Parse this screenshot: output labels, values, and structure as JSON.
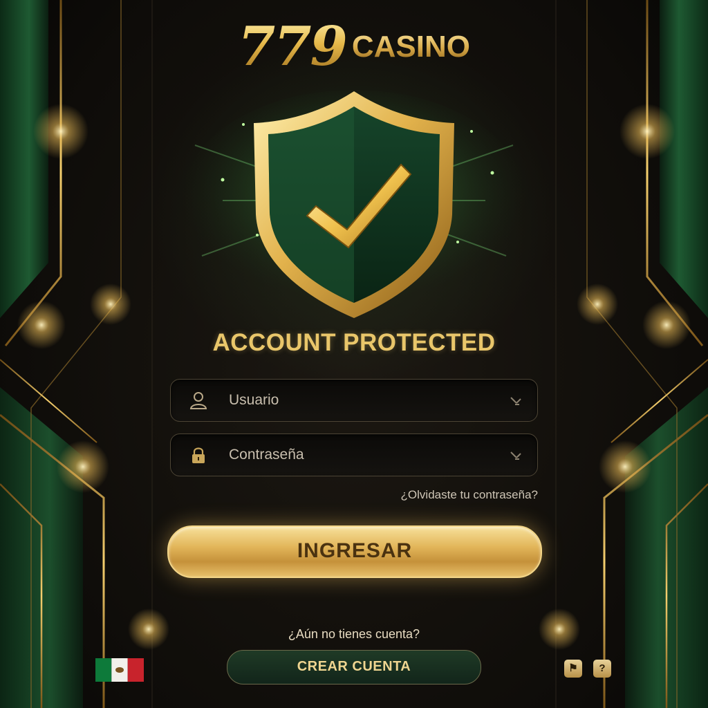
{
  "brand": {
    "number": "779",
    "word": "CASINO"
  },
  "status": {
    "title": "ACCOUNT PROTECTED"
  },
  "form": {
    "username_placeholder": "Usuario",
    "password_placeholder": "Contraseña",
    "forgot_link": "¿Olvidaste tu contraseña?",
    "login_button": "INGRESAR"
  },
  "signup": {
    "prompt": "¿Aún no tienes cuenta?",
    "create_button": "CREAR CUENTA"
  },
  "footer": {
    "language_flag": "mexico-flag-icon",
    "icons": [
      "support-icon",
      "help-icon"
    ]
  },
  "colors": {
    "gold": "#e9c66a",
    "accent_green": "#1f3a26",
    "background": "#0d0b08"
  }
}
